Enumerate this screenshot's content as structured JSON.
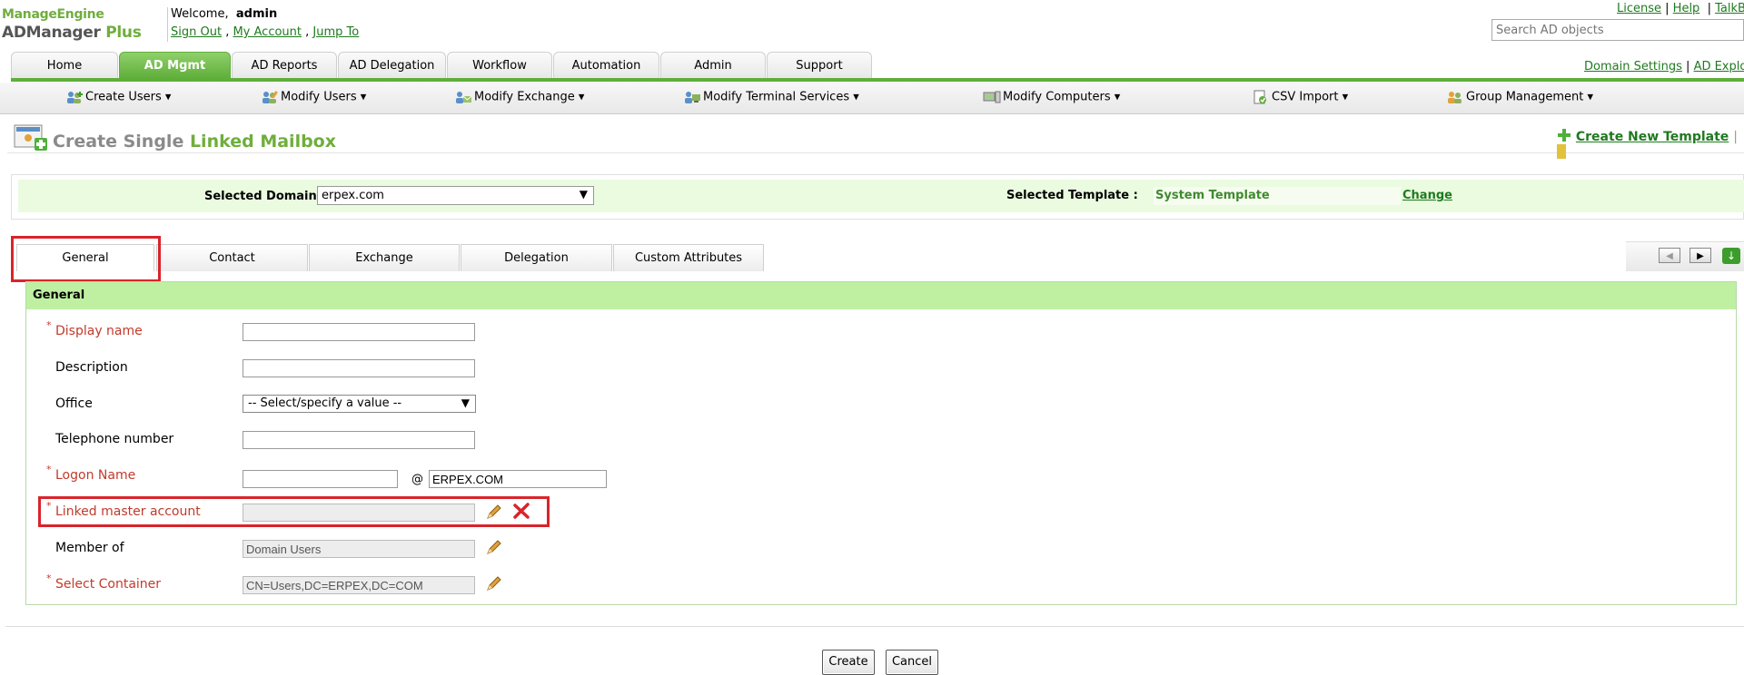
{
  "header": {
    "logo_top": "ManageEngine",
    "logo_bottom": "ADManager",
    "logo_plus": "Plus",
    "welcome_prefix": "Welcome,",
    "username": "admin",
    "sign_out": "Sign Out",
    "my_account": "My Account",
    "jump_to": "Jump To",
    "license": "License",
    "help": "Help",
    "talk": "TalkB",
    "search_placeholder": "Search AD objects",
    "domain_settings": "Domain Settings",
    "ad_explorer": "AD Explo"
  },
  "main_tabs": [
    {
      "label": "Home"
    },
    {
      "label": "AD Mgmt"
    },
    {
      "label": "AD Reports"
    },
    {
      "label": "AD Delegation"
    },
    {
      "label": "Workflow"
    },
    {
      "label": "Automation"
    },
    {
      "label": "Admin"
    },
    {
      "label": "Support"
    }
  ],
  "submenu": [
    {
      "label": "Create Users ▾"
    },
    {
      "label": "Modify Users ▾"
    },
    {
      "label": "Modify Exchange ▾"
    },
    {
      "label": "Modify Terminal Services ▾"
    },
    {
      "label": "Modify Computers ▾"
    },
    {
      "label": "CSV Import ▾"
    },
    {
      "label": "Group Management ▾"
    }
  ],
  "page": {
    "title_prefix": "Create Single",
    "title_highlight": "Linked Mailbox",
    "create_template": "Create New Template",
    "selected_domain_label": "Selected Domain:",
    "selected_domain": "erpex.com",
    "selected_template_label": "Selected Template :",
    "selected_template": "System Template",
    "change": "Change"
  },
  "sub_tabs": [
    {
      "label": "General"
    },
    {
      "label": "Contact"
    },
    {
      "label": "Exchange"
    },
    {
      "label": "Delegation"
    },
    {
      "label": "Custom Attributes"
    }
  ],
  "form": {
    "section_title": "General",
    "display_name_label": "Display name",
    "description_label": "Description",
    "office_label": "Office",
    "office_value": "-- Select/specify a value --",
    "telephone_label": "Telephone number",
    "logon_name_label": "Logon Name",
    "at_symbol": "@",
    "logon_domain": "ERPEX.COM",
    "linked_master_label": "Linked master account",
    "member_of_label": "Member of",
    "member_of_value": "Domain Users",
    "select_container_label": "Select Container",
    "select_container_value": "CN=Users,DC=ERPEX,DC=COM",
    "required_mark": "*"
  },
  "buttons": {
    "create": "Create",
    "cancel": "Cancel"
  },
  "colors": {
    "brand_green": "#5fae3a",
    "highlight_red": "#d9242a",
    "required_label": "#c23a2a"
  }
}
